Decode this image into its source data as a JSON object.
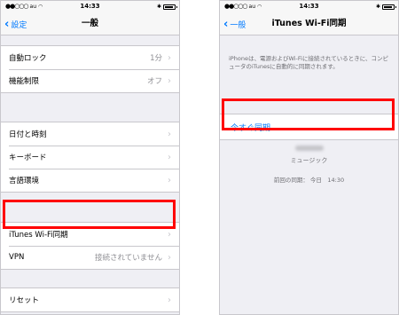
{
  "status_bar": {
    "carrier": "au",
    "time": "14:33"
  },
  "left": {
    "nav": {
      "back_label": "設定",
      "title": "一般"
    },
    "groups": [
      [
        {
          "label": "自動ロック",
          "value": "1分"
        },
        {
          "label": "機能制限",
          "value": "オフ"
        }
      ],
      [
        {
          "label": "日付と時刻",
          "value": ""
        },
        {
          "label": "キーボード",
          "value": ""
        },
        {
          "label": "言語環境",
          "value": ""
        }
      ],
      [
        {
          "label": "iTunes Wi-Fi同期",
          "value": ""
        },
        {
          "label": "VPN",
          "value": "接続されていません"
        }
      ],
      [
        {
          "label": "リセット",
          "value": ""
        }
      ]
    ]
  },
  "right": {
    "nav": {
      "back_label": "一般",
      "title": "iTunes Wi-Fi同期"
    },
    "description": "iPhoneは、電源およびWi-Fiに接続されているときに、コンピュータのiTunesに自動的に同期されます。",
    "sync_button": "今すぐ同期",
    "content_label": "ミュージック",
    "last_sync": "前回の同期： 今日　14:30"
  },
  "colors": {
    "accent": "#007aff",
    "highlight": "#ff0000",
    "background": "#efeff4"
  }
}
